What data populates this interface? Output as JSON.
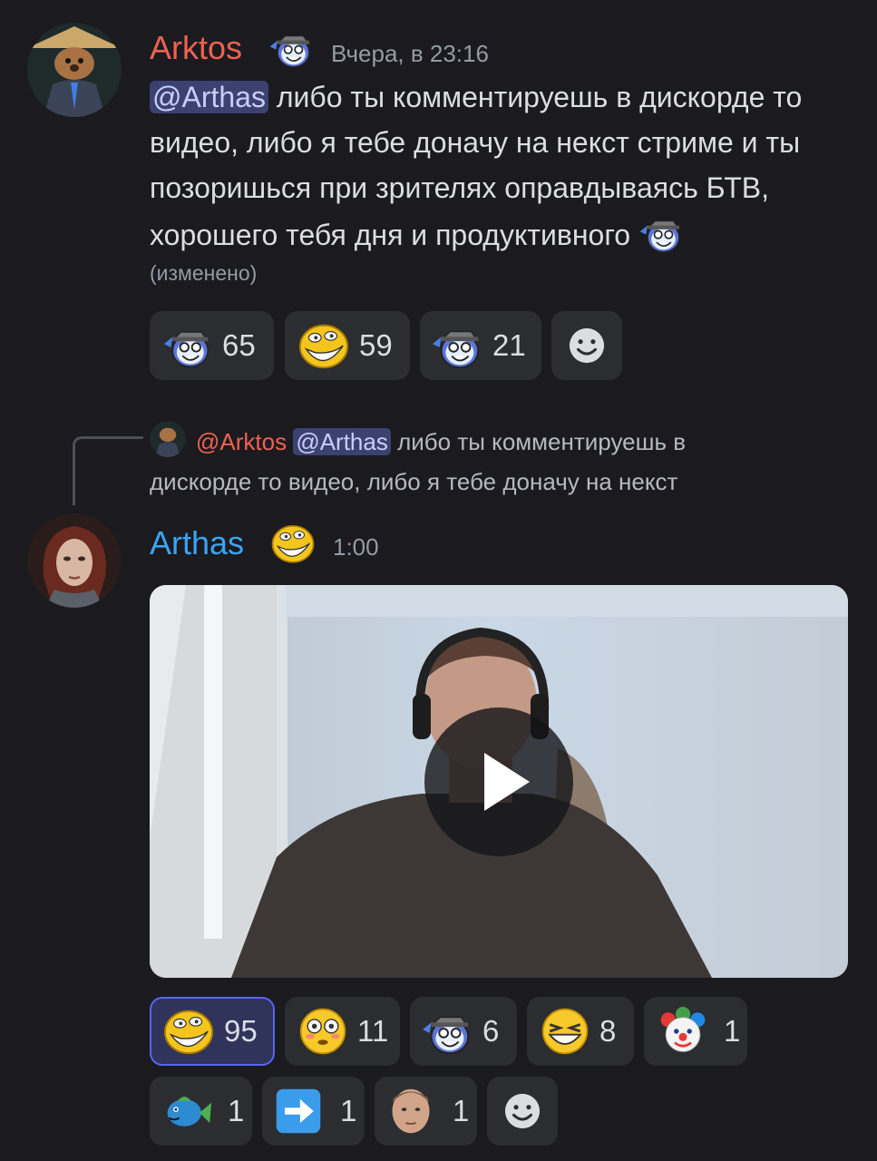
{
  "message1": {
    "username": "Arktos",
    "timestamp": "Вчера, в 23:16",
    "mention": "@Arthas",
    "text": "либо ты комментируешь в дискорде то видео, либо я тебе доначу на некст стриме и ты позоришься при зрителях оправдываясь БТВ, хорошего тебя дня и продуктивного",
    "edited": "(изменено)",
    "reactions": [
      {
        "emoji": "nerd-hat-emoji",
        "count": "65"
      },
      {
        "emoji": "troll-face-emoji",
        "count": "59"
      },
      {
        "emoji": "nerd-hat-blue-emoji",
        "count": "21"
      }
    ]
  },
  "reply": {
    "author": "@Arktos",
    "mention": "@Arthas",
    "text1": "либо ты комментируешь в",
    "text2": "дискорде то видео, либо я тебе доначу на некст"
  },
  "message2": {
    "username": "Arthas",
    "timestamp": "1:00",
    "reactions_row1": [
      {
        "emoji": "troll-face-emoji",
        "count": "95",
        "active": true
      },
      {
        "emoji": "flushed-face-emoji",
        "count": "11"
      },
      {
        "emoji": "nerd-hat-emoji",
        "count": "6"
      },
      {
        "emoji": "squint-grin-emoji",
        "count": "8"
      },
      {
        "emoji": "clown-emoji",
        "count": "1"
      }
    ],
    "reactions_row2": [
      {
        "emoji": "fish-emoji",
        "count": "1"
      },
      {
        "emoji": "arrow-right-emoji",
        "count": "1"
      },
      {
        "emoji": "person-face-emoji",
        "count": "1"
      }
    ]
  },
  "colors": {
    "background": "#1a1a1f",
    "arktos_name": "#f0624f",
    "arthas_name": "#3aa5f2",
    "mention_bg": "#3c4270",
    "reaction_bg": "#2b2d31",
    "reaction_active_border": "#5865f2"
  }
}
